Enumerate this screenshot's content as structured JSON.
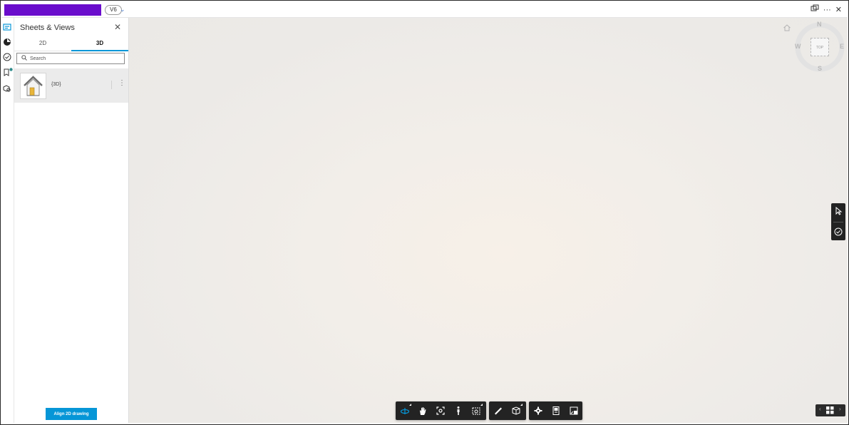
{
  "topbar": {
    "version": "V6",
    "icons": [
      "version-chevron-icon",
      "window-icon",
      "more-icon",
      "close-icon"
    ]
  },
  "left_rail": {
    "items": [
      "sheets-views-icon",
      "model-browser-icon",
      "issues-icon",
      "bookmark-icon",
      "search-models-icon"
    ]
  },
  "panel": {
    "title": "Sheets & Views",
    "tabs": [
      {
        "label": "2D",
        "active": false
      },
      {
        "label": "3D",
        "active": true
      }
    ],
    "search_placeholder": "Search",
    "views": [
      {
        "label": "{3D}",
        "icon": "house-thumbnail-icon"
      }
    ],
    "align_button": "Align 2D drawing"
  },
  "viewcube": {
    "north": "N",
    "south": "S",
    "east": "E",
    "west": "W",
    "face": "TOP"
  },
  "side_toolbar": [
    "select-cursor-icon",
    "markup-check-icon"
  ],
  "bottom_toolbar": {
    "groups": [
      [
        "orbit-icon",
        "pan-icon",
        "fit-view-icon",
        "first-person-icon",
        "camera-icon"
      ],
      [
        "measure-icon",
        "section-icon"
      ],
      [
        "settings-icon",
        "properties-icon",
        "fullscreen-icon"
      ]
    ]
  },
  "colors": {
    "accent": "#0696d7",
    "redaction": "#6a0dcc",
    "toolbar_bg": "#232323"
  }
}
